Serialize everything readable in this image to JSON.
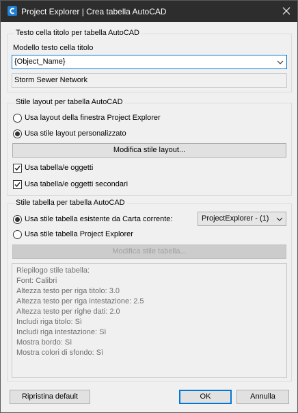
{
  "window": {
    "title": "Project Explorer | Crea tabella AutoCAD",
    "app_icon": "project-explorer-app-icon",
    "close_icon": "close-icon"
  },
  "title_text_group": {
    "title": "Testo cella titolo per tabella AutoCAD",
    "template_label": "Modello testo cella titolo",
    "template_value": "{Object_Name}",
    "preview_value": "Storm Sewer Network"
  },
  "layout_group": {
    "title": "Stile layout per tabella AutoCAD",
    "radio_window_layout": {
      "label": "Usa layout della finestra Project Explorer",
      "selected": false
    },
    "radio_custom_layout": {
      "label": "Usa stile layout personalizzato",
      "selected": true
    },
    "modify_layout_button": "Modifica stile layout...",
    "check_object_tables": {
      "label": "Usa tabella/e oggetti",
      "checked": true
    },
    "check_secondary_tables": {
      "label": "Usa tabella/e oggetti secondari",
      "checked": true
    }
  },
  "table_style_group": {
    "title": "Stile tabella per tabella AutoCAD",
    "radio_existing_style": {
      "label": "Usa stile tabella esistente da Carta corrente:",
      "selected": true
    },
    "existing_style_value": "ProjectExplorer - (1)",
    "radio_project_style": {
      "label": "Usa stile tabella Project Explorer",
      "selected": false
    },
    "modify_table_button": "Modifica stile tabella...",
    "summary_lines": [
      "Riepilogo stile tabella:",
      "Font: Calibri",
      "Altezza testo per riga titolo: 3.0",
      "Altezza testo per riga intestazione: 2.5",
      "Altezza testo per righe dati: 2.0",
      "Includi riga titolo: Sì",
      "Includi riga intestazione: Sì",
      "Mostra bordo: Sì",
      "Mostra colori di sfondo: Sì"
    ]
  },
  "footer": {
    "reset_button": "Ripristina default",
    "ok_button": "OK",
    "cancel_button": "Annulla"
  },
  "colors": {
    "titlebar": "#2d2d2d",
    "accent": "#0078d7",
    "dialog_bg": "#f0f0f0"
  }
}
